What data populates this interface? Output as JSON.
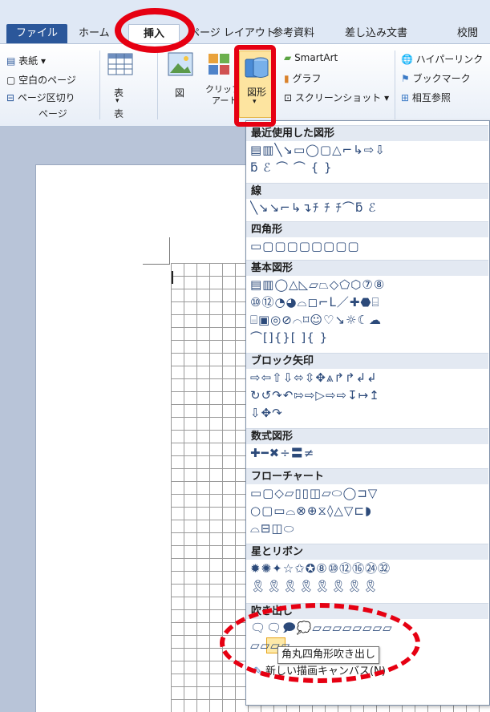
{
  "tabs": {
    "file": "ファイル",
    "home": "ホーム",
    "insert": "挿入",
    "page_layout": "ページ レイアウト",
    "references": "参考資料",
    "mailings": "差し込み文書",
    "review": "校閲"
  },
  "ribbon": {
    "pages_group": {
      "cover": "表紙 ▾",
      "blank_page": "空白のページ",
      "page_break": "ページ区切り",
      "label": "ページ"
    },
    "table_group": {
      "table": "表",
      "label": "表"
    },
    "illustrations": {
      "picture": "図",
      "clipart_1": "クリップ",
      "clipart_2": "アート",
      "shapes": "図形",
      "shapes_arrow": "▾",
      "smartart": "SmartArt",
      "chart": "グラフ",
      "screenshot": "スクリーンショット ▾"
    },
    "links": {
      "hyperlink": "ハイパーリンク",
      "bookmark": "ブックマーク",
      "cross_reference": "相互参照"
    }
  },
  "shapes_panel": {
    "categories": [
      {
        "title": "最近使用した図形",
        "rows": [
          "▤▥╲↘▭◯▢△⌐↳⇨⇩",
          "ƃ ℰ ⌒ ⌒ { }"
        ]
      },
      {
        "title": "線",
        "rows": [
          "╲↘↘⌐↳↴ﾁ ﾁ ﾁ⌒ƃ ℰ"
        ]
      },
      {
        "title": "四角形",
        "rows": [
          "▭▢▢▢▢▢▢▢▢"
        ]
      },
      {
        "title": "基本図形",
        "rows": [
          "▤▥◯△◺▱⏢◇⬠⬡⑦⑧",
          "⑩⑫◔◕⌓◻⌐ᒪ／✚⬣⌸",
          "⌸▣◎⊘⌒⌑☺♡↘☼☾☁",
          "⌒[]{}[ ]{ }"
        ]
      },
      {
        "title": "ブロック矢印",
        "rows": [
          "⇨⇦⇧⇩⬄⇳✥⩓↱↱↲↲",
          "↻↺↷↶⇰⇨▷⇨⇨↧↦↥",
          "⇩✥↷"
        ]
      },
      {
        "title": "数式図形",
        "rows": [
          "✚━✖÷〓≠"
        ]
      },
      {
        "title": "フローチャート",
        "rows": [
          "▭▢◇▱▯▯◫▱⬭◯⊐▽",
          "○▢▭⌓⊗⊕⧖◊△▽⊏◗",
          "⌓⊟◫⬭"
        ]
      },
      {
        "title": "星とリボン",
        "rows": [
          "✹✺✦☆✩✪⑧⑩⑫⑯㉔㉜",
          "🎗🎗🎗🎗🎗🎗🎗🎗"
        ]
      },
      {
        "title": "吹き出し",
        "rows": [
          "🗨🗨🗩💭▱▱▱▱▱▱▱▱",
          "▱▱▱▱"
        ]
      }
    ],
    "tooltip": "角丸四角形吹き出し",
    "more_shapes": "新しい描画キャンバス(N)"
  },
  "colors": {
    "accent": "#2b579a",
    "annotation_red": "#e60012"
  }
}
